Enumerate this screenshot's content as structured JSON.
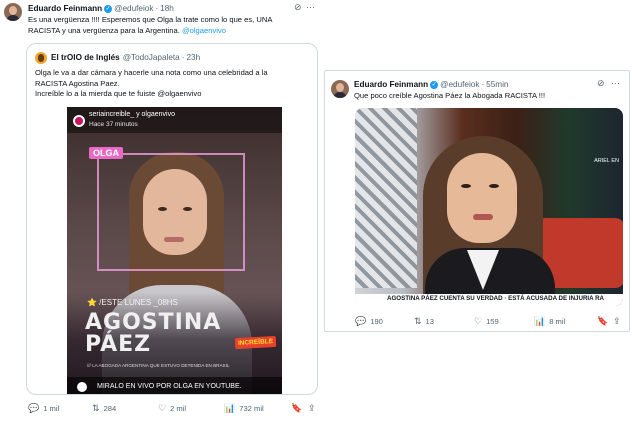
{
  "left_tweet": {
    "author_name": "Eduardo Feinmann",
    "verified_mark": "✓",
    "handle": "@edufeiok",
    "separator": "·",
    "time": "18h",
    "text_line1": "Es una vergüenza !!!!  Esperemos que Olga la trate como lo que es, UNA",
    "text_line2_prefix": "RACISTA y una vergüenza para la Argentina. ",
    "text_line2_mention": "@olgaenvivo",
    "quote": {
      "author_name": "El trOlO de Inglés",
      "handle": "@TodoJapaleta",
      "separator": "·",
      "time": "23h",
      "text_line1": "Olga le va a dar cámara y hacerle una nota como una celebridad a la",
      "text_line2": "RACISTA Agostina Paez.",
      "text_line3": "Increíble lo a la mierda que te fuiste @olgaenvivo",
      "media": {
        "ig_names": "seriaincreible_ y olgaenvivo",
        "ig_time": "Hace 37 minutos",
        "olga_tag": "OLGA",
        "este_lunes": "⭐ /ESTE LUNES _08HS",
        "big_name_1": "AGOSTINA",
        "big_name_2": "PÁEZ",
        "sub_line": "/// LA ABOGADA ARGENTINA QUE ESTUVO DETENIDA EN BRASIL",
        "logo_badge": "INCREÍBLE",
        "bottom_text": "MIRALO EN VIVO POR OLGA EN YOUTUBE."
      }
    },
    "actions": {
      "replies": "1 mil",
      "reposts": "284",
      "likes": "2 mil",
      "views": "732 mil"
    }
  },
  "right_tweet": {
    "author_name": "Eduardo Feinmann",
    "verified_mark": "✓",
    "handle": "@edufeiok",
    "separator": "·",
    "time": "55min",
    "text": "Que poco creíble Agostina Páez la Abogada RACISTA !!!",
    "media": {
      "corner_tag": "ARIEL EN",
      "ticker": "AGOSTINA PÁEZ CUENTA SU VERDAD · ESTÁ ACUSADA DE INJURIA RA"
    },
    "actions": {
      "replies": "190",
      "reposts": "13",
      "likes": "159",
      "views": "8 mil"
    }
  },
  "icons": {
    "grok": "⊘",
    "more": "···",
    "reply": "💬",
    "repost": "⇅",
    "like": "♡",
    "views": "📊",
    "bookmark": "🔖",
    "share": "⇪"
  }
}
